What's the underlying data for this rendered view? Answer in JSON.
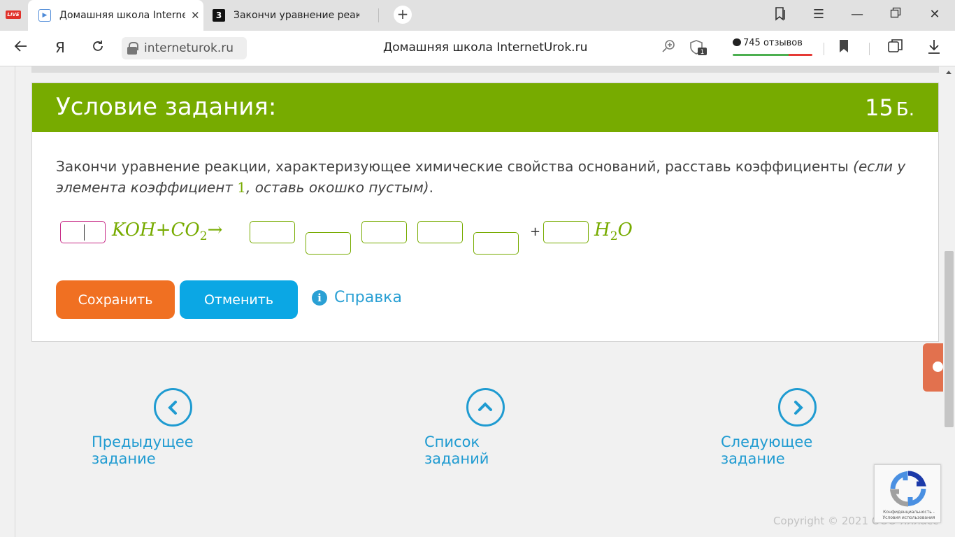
{
  "browser": {
    "live_badge": "LIVE",
    "tabs": [
      {
        "title": "Домашняя школа InternetUrok.ru",
        "active": true
      },
      {
        "title": "Закончи уравнение реакции",
        "active": false,
        "favicon_text": "3"
      }
    ],
    "url": "interneturok.ru",
    "page_title": "Домашняя школа InternetUrok.ru",
    "reviews": "745 отзывов",
    "downloads_badge": "1"
  },
  "task": {
    "header_title": "Условие задания:",
    "points_value": "15",
    "points_unit": "Б.",
    "text_main": "Закончи уравнение реакции, характеризующее химические свойства оснований, расставь коэффициенты",
    "text_hint_a": "(если у элемента коэффициент",
    "text_hint_num": "1",
    "text_hint_b": ", оставь окошко пустым)",
    "text_end": ".",
    "equation": {
      "reactant1": "KOH",
      "plus_op": "+",
      "reactant2": "CO",
      "reactant2_sub": "2",
      "arrow": "→",
      "plus": "+",
      "product": "H",
      "product_sub": "2",
      "product_tail": "O"
    },
    "save_label": "Сохранить",
    "cancel_label": "Отменить",
    "help_label": "Справка"
  },
  "navigation": {
    "prev_label": "Предыдущее задание",
    "list_label": "Список заданий",
    "next_label": "Следующее задание"
  },
  "footer": {
    "copyright": "Copyright © 2021 ООО Ялласс",
    "recaptcha_note": "Конфиденциальность - Условия использования"
  },
  "colors": {
    "header_green": "#77ab00",
    "save_orange": "#f07022",
    "cancel_blue": "#0ba7e4",
    "link_blue": "#1f9bd1"
  }
}
